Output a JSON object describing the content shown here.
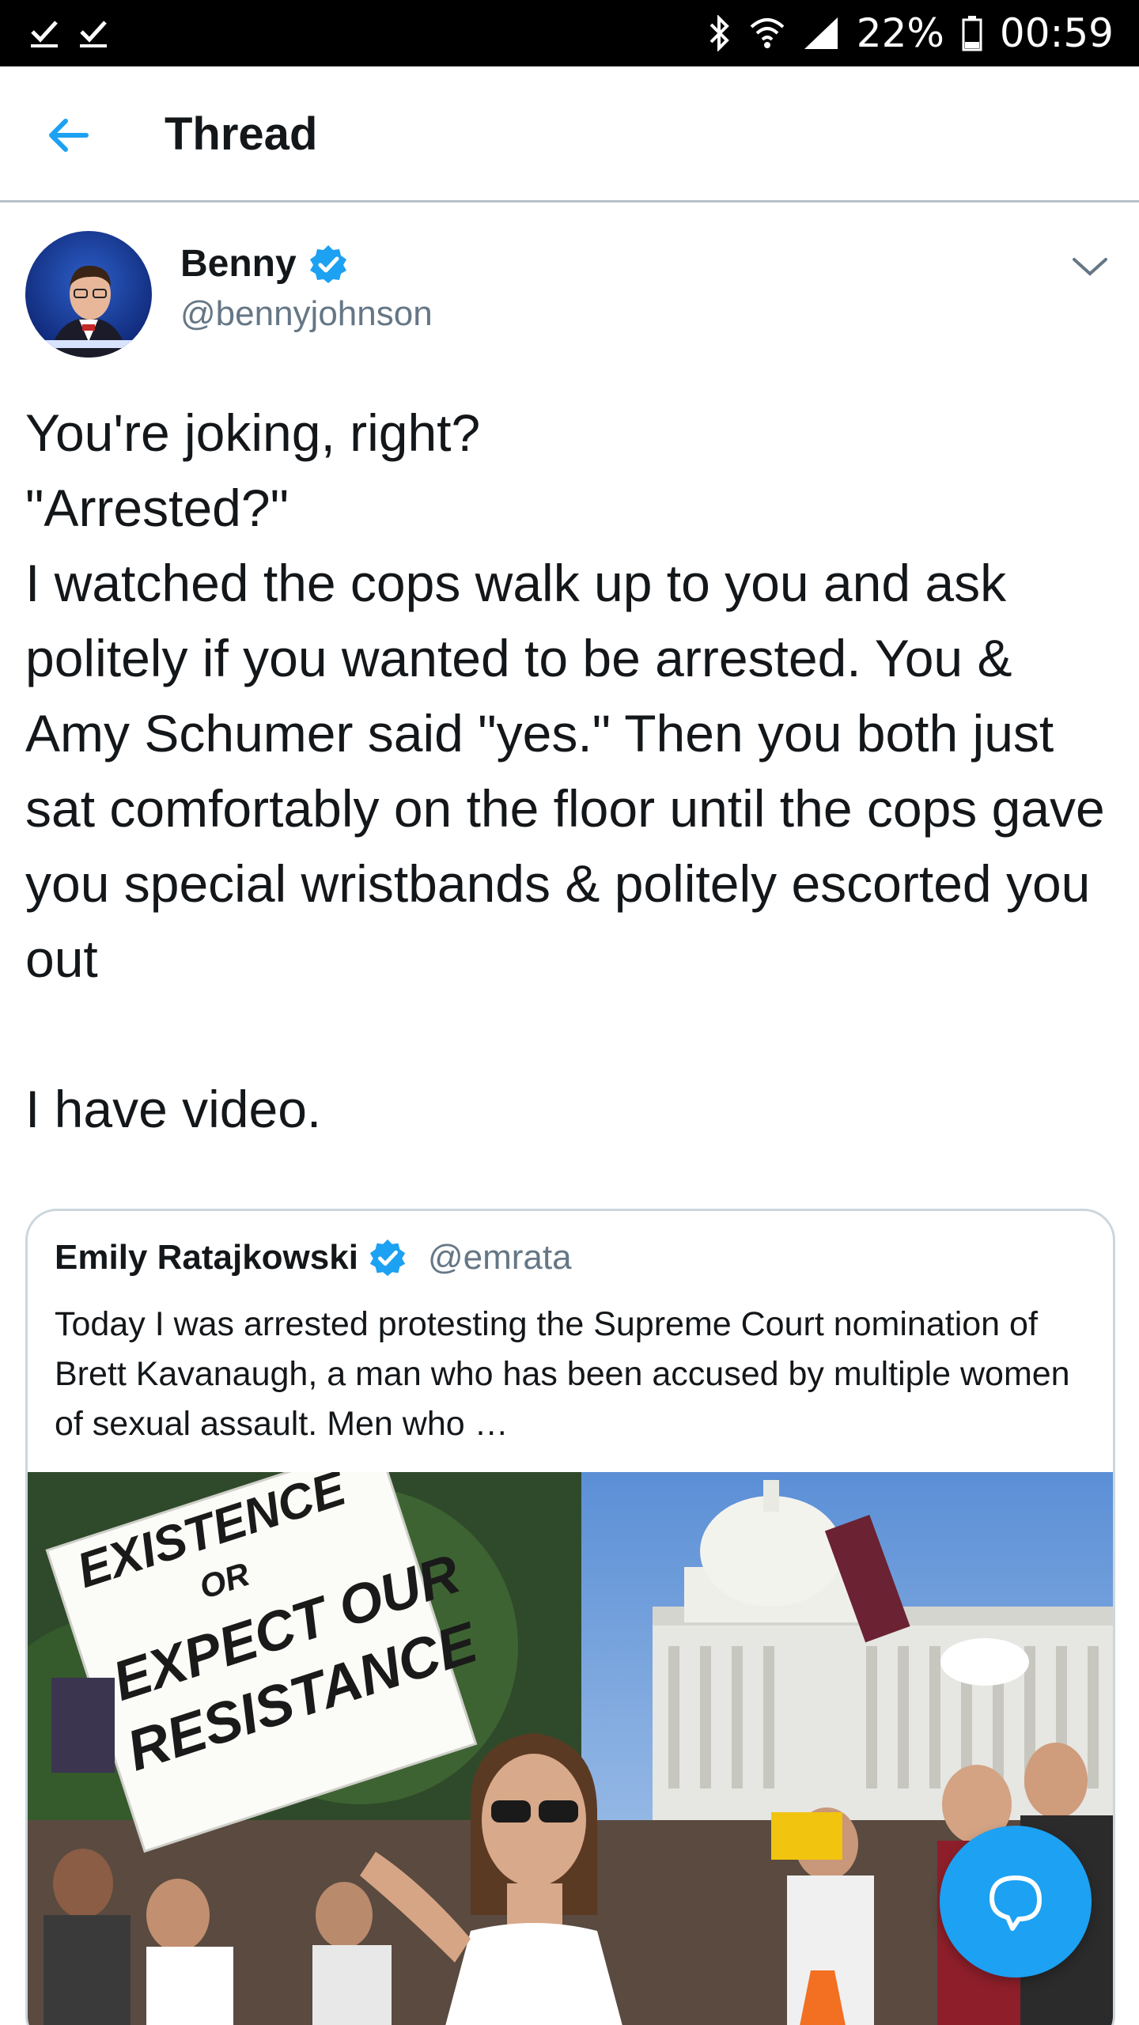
{
  "status_bar": {
    "battery_percent": "22%",
    "time": "00:59"
  },
  "header": {
    "title": "Thread"
  },
  "tweet": {
    "author_name": "Benny",
    "author_handle": "@bennyjohnson",
    "text": "You're joking, right?\n\"Arrested?\"\nI watched the cops walk up to you and ask politely if you wanted to be arrested. You & Amy Schumer said \"yes.\" Then you both just sat comfortably on the floor until the cops gave you special wristbands & politely escorted you out\n\nI have video."
  },
  "quoted_tweet": {
    "author_name": "Emily Ratajkowski",
    "author_handle": "@emrata",
    "text": "Today I was arrested protesting the Supreme Court nomination of Brett Kavanaugh, a man who has been accused by multiple women of sexual assault. Men who …",
    "sign_text": [
      "EXISTENCE",
      "OR",
      "EXPECT OUR",
      "RESISTANCE"
    ]
  },
  "colors": {
    "accent": "#1da1f2",
    "secondary_text": "#657786",
    "border": "#ccd6dd"
  },
  "icons": {
    "back": "arrow-left-icon",
    "verified": "verified-badge-icon",
    "chevron": "chevron-down-icon",
    "compose": "reply-bubble-icon"
  }
}
